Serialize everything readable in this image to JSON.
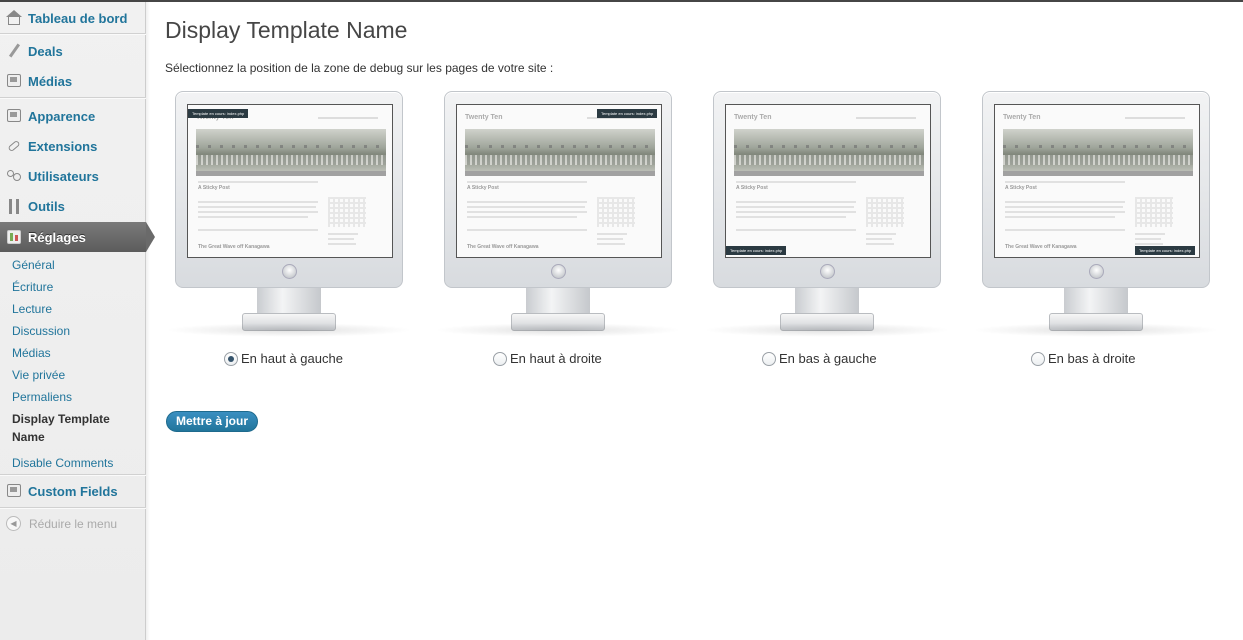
{
  "sidebar": {
    "dashboard": {
      "label": "Tableau de bord",
      "icon": "home-icon"
    },
    "items": [
      {
        "label": "Deals",
        "icon": "pin-icon"
      },
      {
        "label": "Médias",
        "icon": "media-icon"
      },
      {
        "label": "Apparence",
        "icon": "appearance-icon"
      },
      {
        "label": "Extensions",
        "icon": "plugin-icon"
      },
      {
        "label": "Utilisateurs",
        "icon": "users-icon"
      },
      {
        "label": "Outils",
        "icon": "tools-icon"
      },
      {
        "label": "Réglages",
        "icon": "settings-icon"
      }
    ],
    "submenu": [
      "Général",
      "Écriture",
      "Lecture",
      "Discussion",
      "Médias",
      "Vie privée",
      "Permaliens",
      "Display Template",
      "Name",
      "Disable Comments"
    ],
    "custom_fields": {
      "label": "Custom Fields",
      "icon": "custom-fields-icon"
    },
    "collapse": "Réduire le menu"
  },
  "main": {
    "title": "Display Template Name",
    "instruction": "Sélectionnez la position de la zone de debug sur les pages de votre site :",
    "preview": {
      "site_title": "Twenty Ten",
      "post_title": "A Sticky Post",
      "post_title2": "The Great Wave off Kanagawa",
      "badge_text": "Template en cours: index.php"
    },
    "options": [
      {
        "label": "En haut à gauche",
        "checked": true
      },
      {
        "label": "En haut à droite",
        "checked": false
      },
      {
        "label": "En bas à gauche",
        "checked": false
      },
      {
        "label": "En bas à droite",
        "checked": false
      }
    ],
    "submit_label": "Mettre à jour"
  },
  "colors": {
    "link": "#21759b",
    "active_menu": "#6a6a6a",
    "badge": "#2b3a42"
  }
}
